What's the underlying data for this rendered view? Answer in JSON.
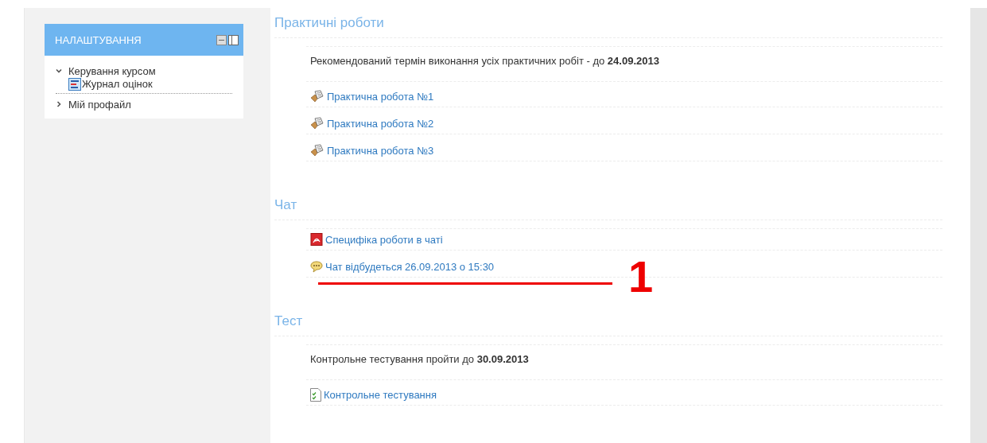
{
  "settings_block": {
    "title": "НАЛАШТУВАННЯ",
    "items": [
      {
        "label": "Керування курсом",
        "expanded": true,
        "children": [
          {
            "label": "Журнал оцінок",
            "kind": "gradebook"
          }
        ]
      },
      {
        "label": "Мій профайл",
        "expanded": false
      }
    ]
  },
  "sections": [
    {
      "title": "Практичні роботи",
      "items": [
        {
          "kind": "text",
          "text": "Рекомендований термін виконання усіх практичних робіт - до **24.09.2013**"
        },
        {
          "kind": "assignment",
          "text": "Практична робота №1"
        },
        {
          "kind": "assignment",
          "text": "Практична робота №2"
        },
        {
          "kind": "assignment",
          "text": "Практична робота №3"
        }
      ]
    },
    {
      "title": "Чат",
      "items": [
        {
          "kind": "pdf",
          "text": "Специфіка роботи в чаті"
        },
        {
          "kind": "chat",
          "text": "Чат відбудеться 26.09.2013 о 15:30",
          "annotation": "1"
        }
      ]
    },
    {
      "title": "Тест",
      "items": [
        {
          "kind": "text",
          "text": "Контрольне тестування пройти до **30.09.2013**"
        },
        {
          "kind": "quiz",
          "text": "Контрольне тестування"
        }
      ]
    }
  ]
}
